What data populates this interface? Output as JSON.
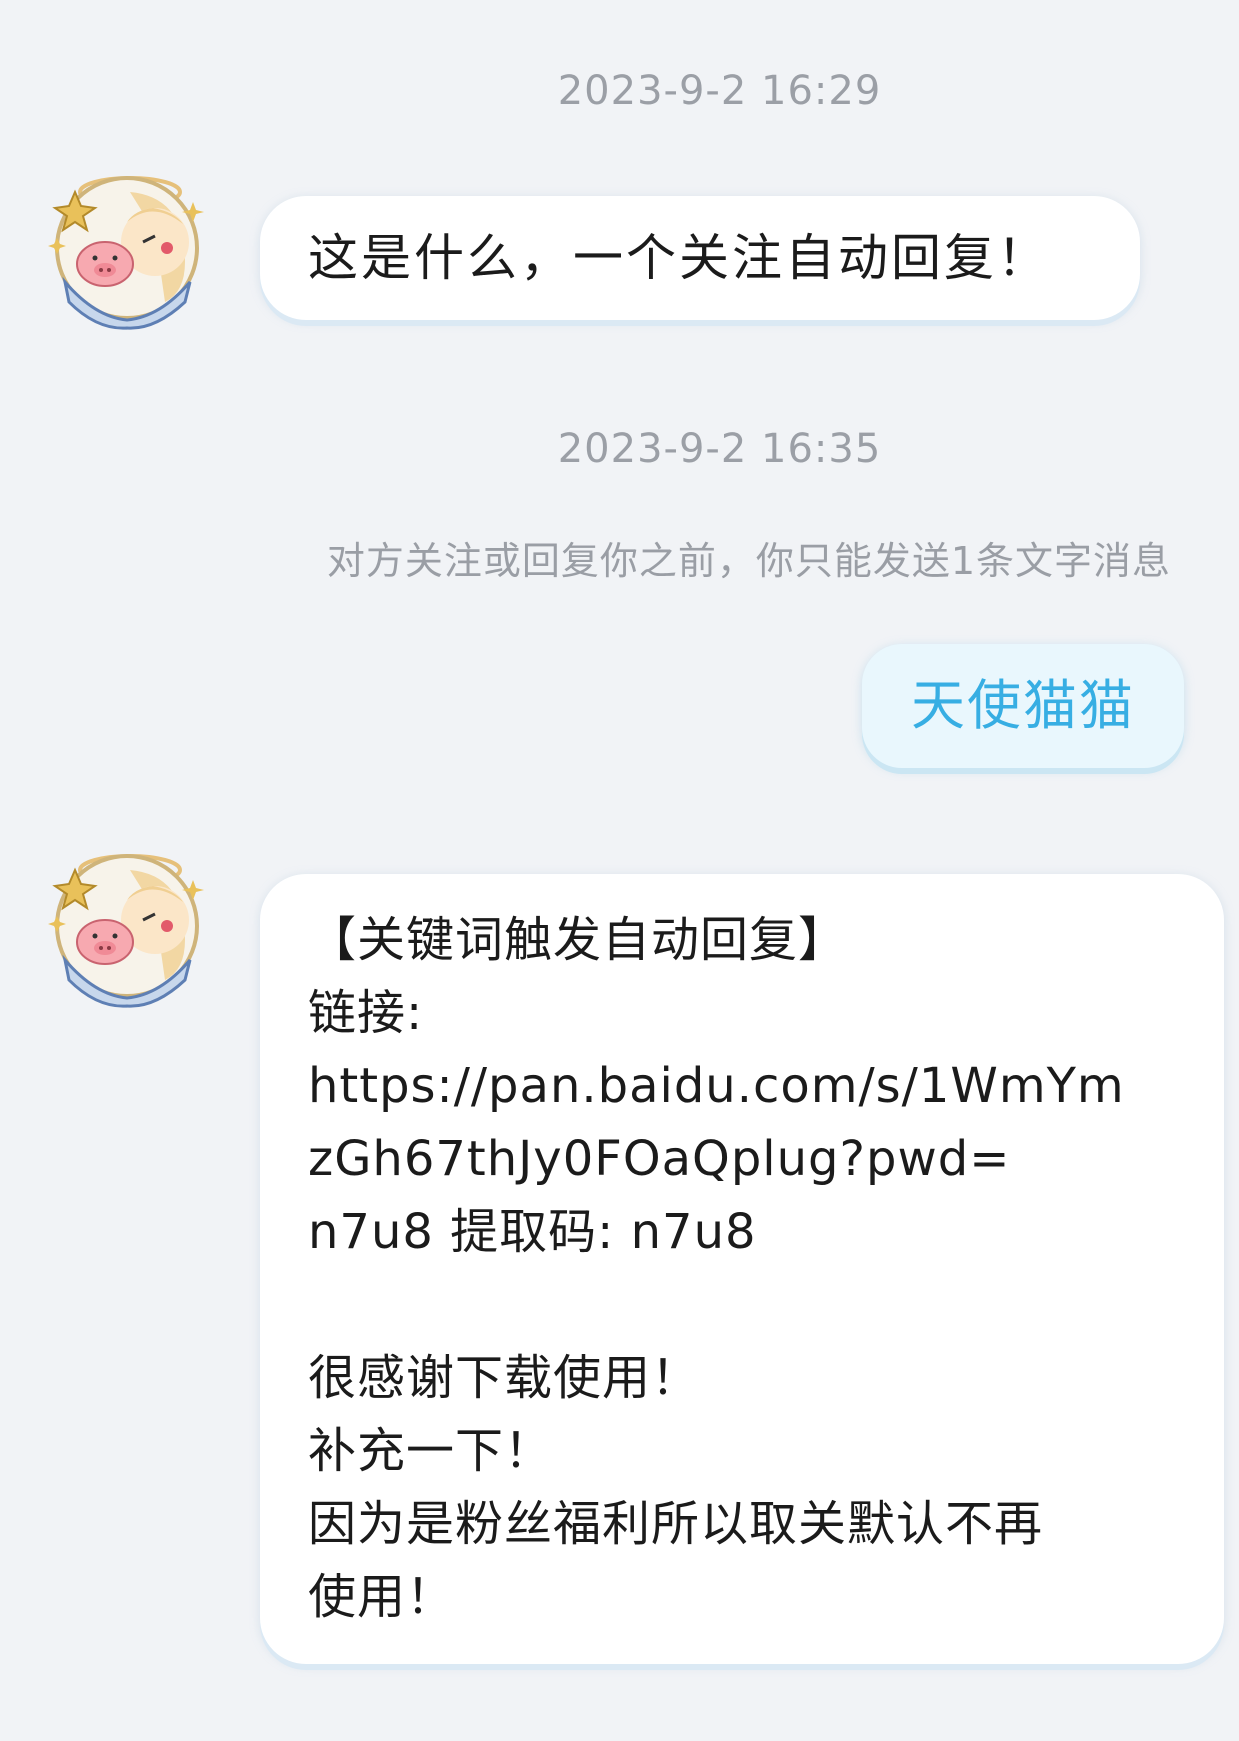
{
  "messages": [
    {
      "timestamp": "2023-9-2 16:29",
      "sender": "other",
      "text": "这是什么，一个关注自动回复！"
    },
    {
      "timestamp": "2023-9-2 16:35",
      "system_note": "对方关注或回复你之前，你只能发送1条文字消息",
      "sender": "me",
      "text": "天使猫猫"
    },
    {
      "sender": "other",
      "lines": [
        "【关键词触发自动回复】",
        "链接:",
        "https://pan.baidu.com/s/1WmYm",
        "zGh67thJy0FOaQplug?pwd=",
        "n7u8 提取码: n7u8",
        "",
        "很感谢下载使用！",
        "补充一下！",
        "因为是粉丝福利所以取关默认不再",
        "使用！"
      ]
    }
  ],
  "colors": {
    "background": "#f1f3f6",
    "bubble_other": "#ffffff",
    "bubble_me": "#e9f7fd",
    "bubble_me_text": "#37aee3",
    "timestamp": "#9b9fa6"
  },
  "icons": {
    "avatar": "anime-girl-with-pig-avatar-icon"
  }
}
